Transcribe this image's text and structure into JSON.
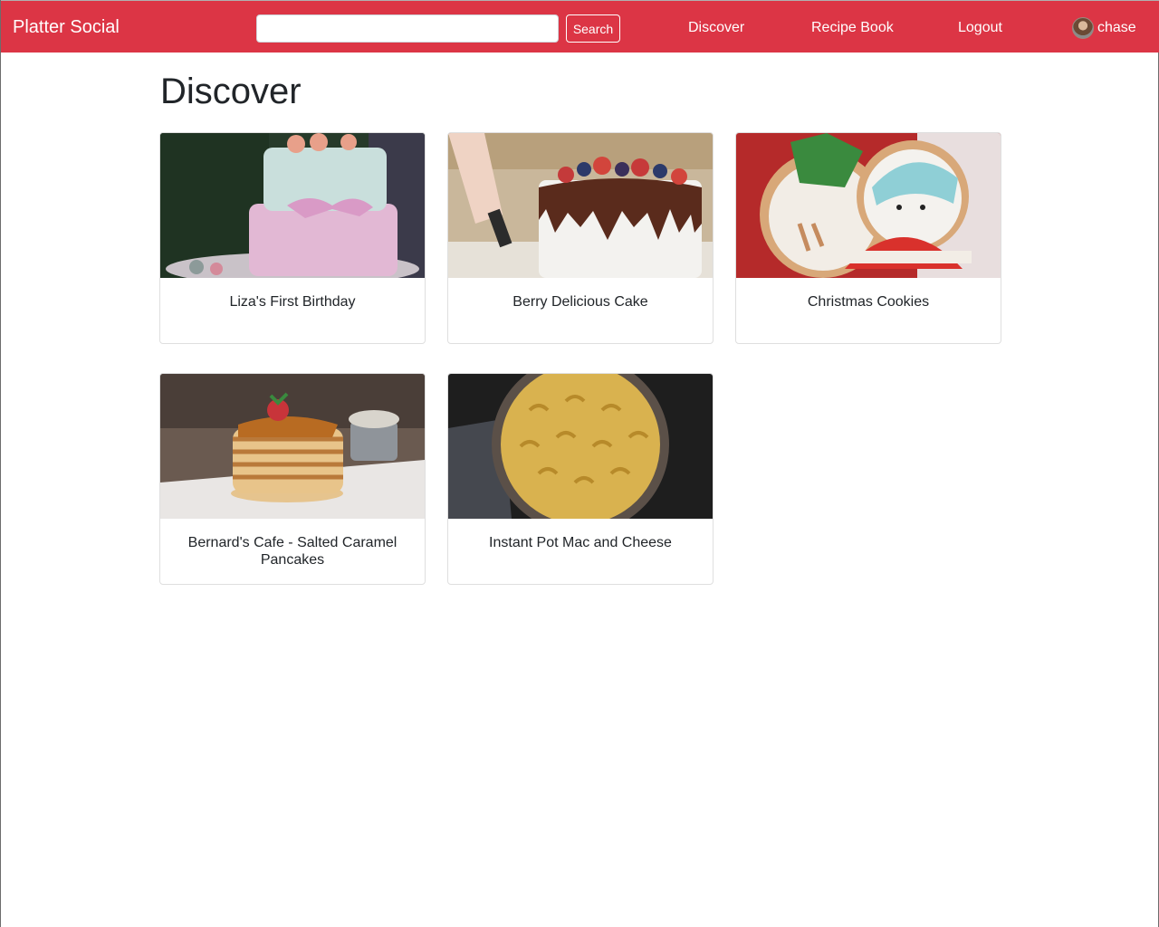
{
  "navbar": {
    "brand": "Platter Social",
    "search_placeholder": "",
    "search_label": "Search",
    "links": {
      "discover": "Discover",
      "recipe_book": "Recipe Book",
      "logout": "Logout"
    },
    "username": "chase",
    "color": "#dc3545"
  },
  "main": {
    "title": "Discover",
    "cards": [
      {
        "title": "Liza's First Birthday",
        "image": "pink-birthday-cake-photo"
      },
      {
        "title": "Berry Delicious Cake",
        "image": "berry-drip-cake-photo"
      },
      {
        "title": "Christmas Cookies",
        "image": "decorated-christmas-cookies-photo"
      },
      {
        "title": "Bernard's Cafe - Salted Caramel Pancakes",
        "image": "caramel-pancake-stack-photo"
      },
      {
        "title": "Instant Pot Mac and Cheese",
        "image": "mac-and-cheese-bowl-photo"
      }
    ]
  }
}
